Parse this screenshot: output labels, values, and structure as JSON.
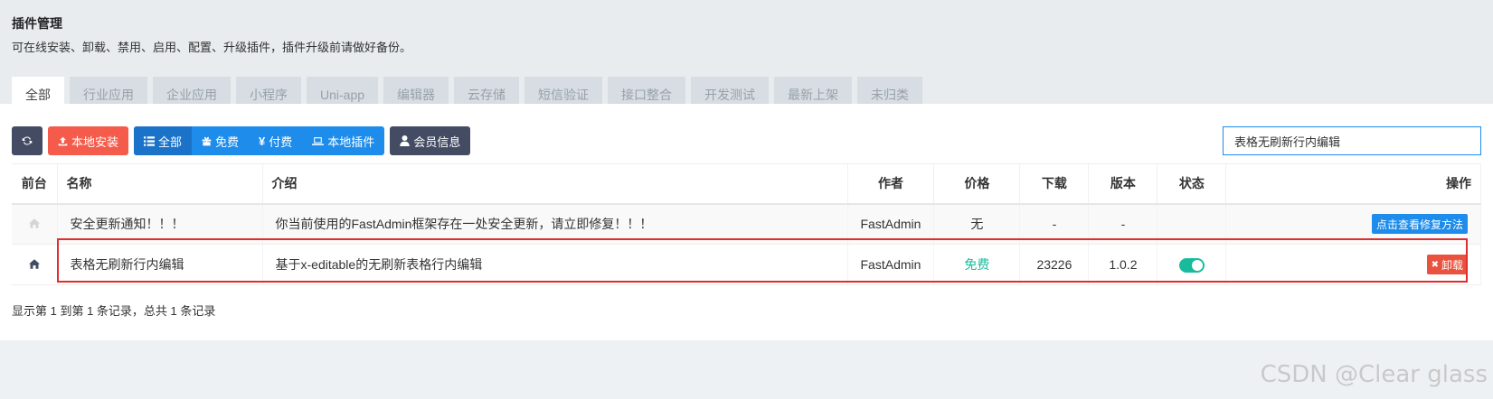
{
  "header": {
    "title": "插件管理",
    "description": "可在线安装、卸载、禁用、启用、配置、升级插件，插件升级前请做好备份。"
  },
  "tabs": [
    {
      "label": "全部",
      "active": true
    },
    {
      "label": "行业应用"
    },
    {
      "label": "企业应用"
    },
    {
      "label": "小程序"
    },
    {
      "label": "Uni-app"
    },
    {
      "label": "编辑器"
    },
    {
      "label": "云存储"
    },
    {
      "label": "短信验证"
    },
    {
      "label": "接口整合"
    },
    {
      "label": "开发测试"
    },
    {
      "label": "最新上架"
    },
    {
      "label": "未归类"
    }
  ],
  "toolbar": {
    "refresh_icon": "refresh-icon",
    "local_install": "本地安装",
    "filter_all": "全部",
    "filter_free": "免费",
    "filter_paid": "付费",
    "filter_local": "本地插件",
    "member_info": "会员信息",
    "search_value": "表格无刷新行内编辑"
  },
  "table": {
    "headers": [
      "前台",
      "名称",
      "介绍",
      "作者",
      "价格",
      "下载",
      "版本",
      "状态",
      "操作"
    ],
    "rows": [
      {
        "name": "安全更新通知！！！",
        "intro": "你当前使用的FastAdmin框架存在一处安全更新，请立即修复！！！",
        "author": "FastAdmin",
        "price": "无",
        "downloads": "-",
        "version": "-",
        "action": "点击查看修复方法"
      },
      {
        "name": "表格无刷新行内编辑",
        "intro": "基于x-editable的无刷新表格行内编辑",
        "author": "FastAdmin",
        "price": "免费",
        "downloads": "23226",
        "version": "1.0.2",
        "status_on": true,
        "action": "卸载"
      }
    ]
  },
  "pagination_info": "显示第 1 到第 1 条记录，总共 1 条记录",
  "watermark": "CSDN @Clear glass",
  "colors": {
    "primary": "#1d8ceb",
    "danger": "#f55b4a",
    "dark": "#444c63",
    "success": "#18bc9c",
    "highlight": "#e02d2d"
  }
}
